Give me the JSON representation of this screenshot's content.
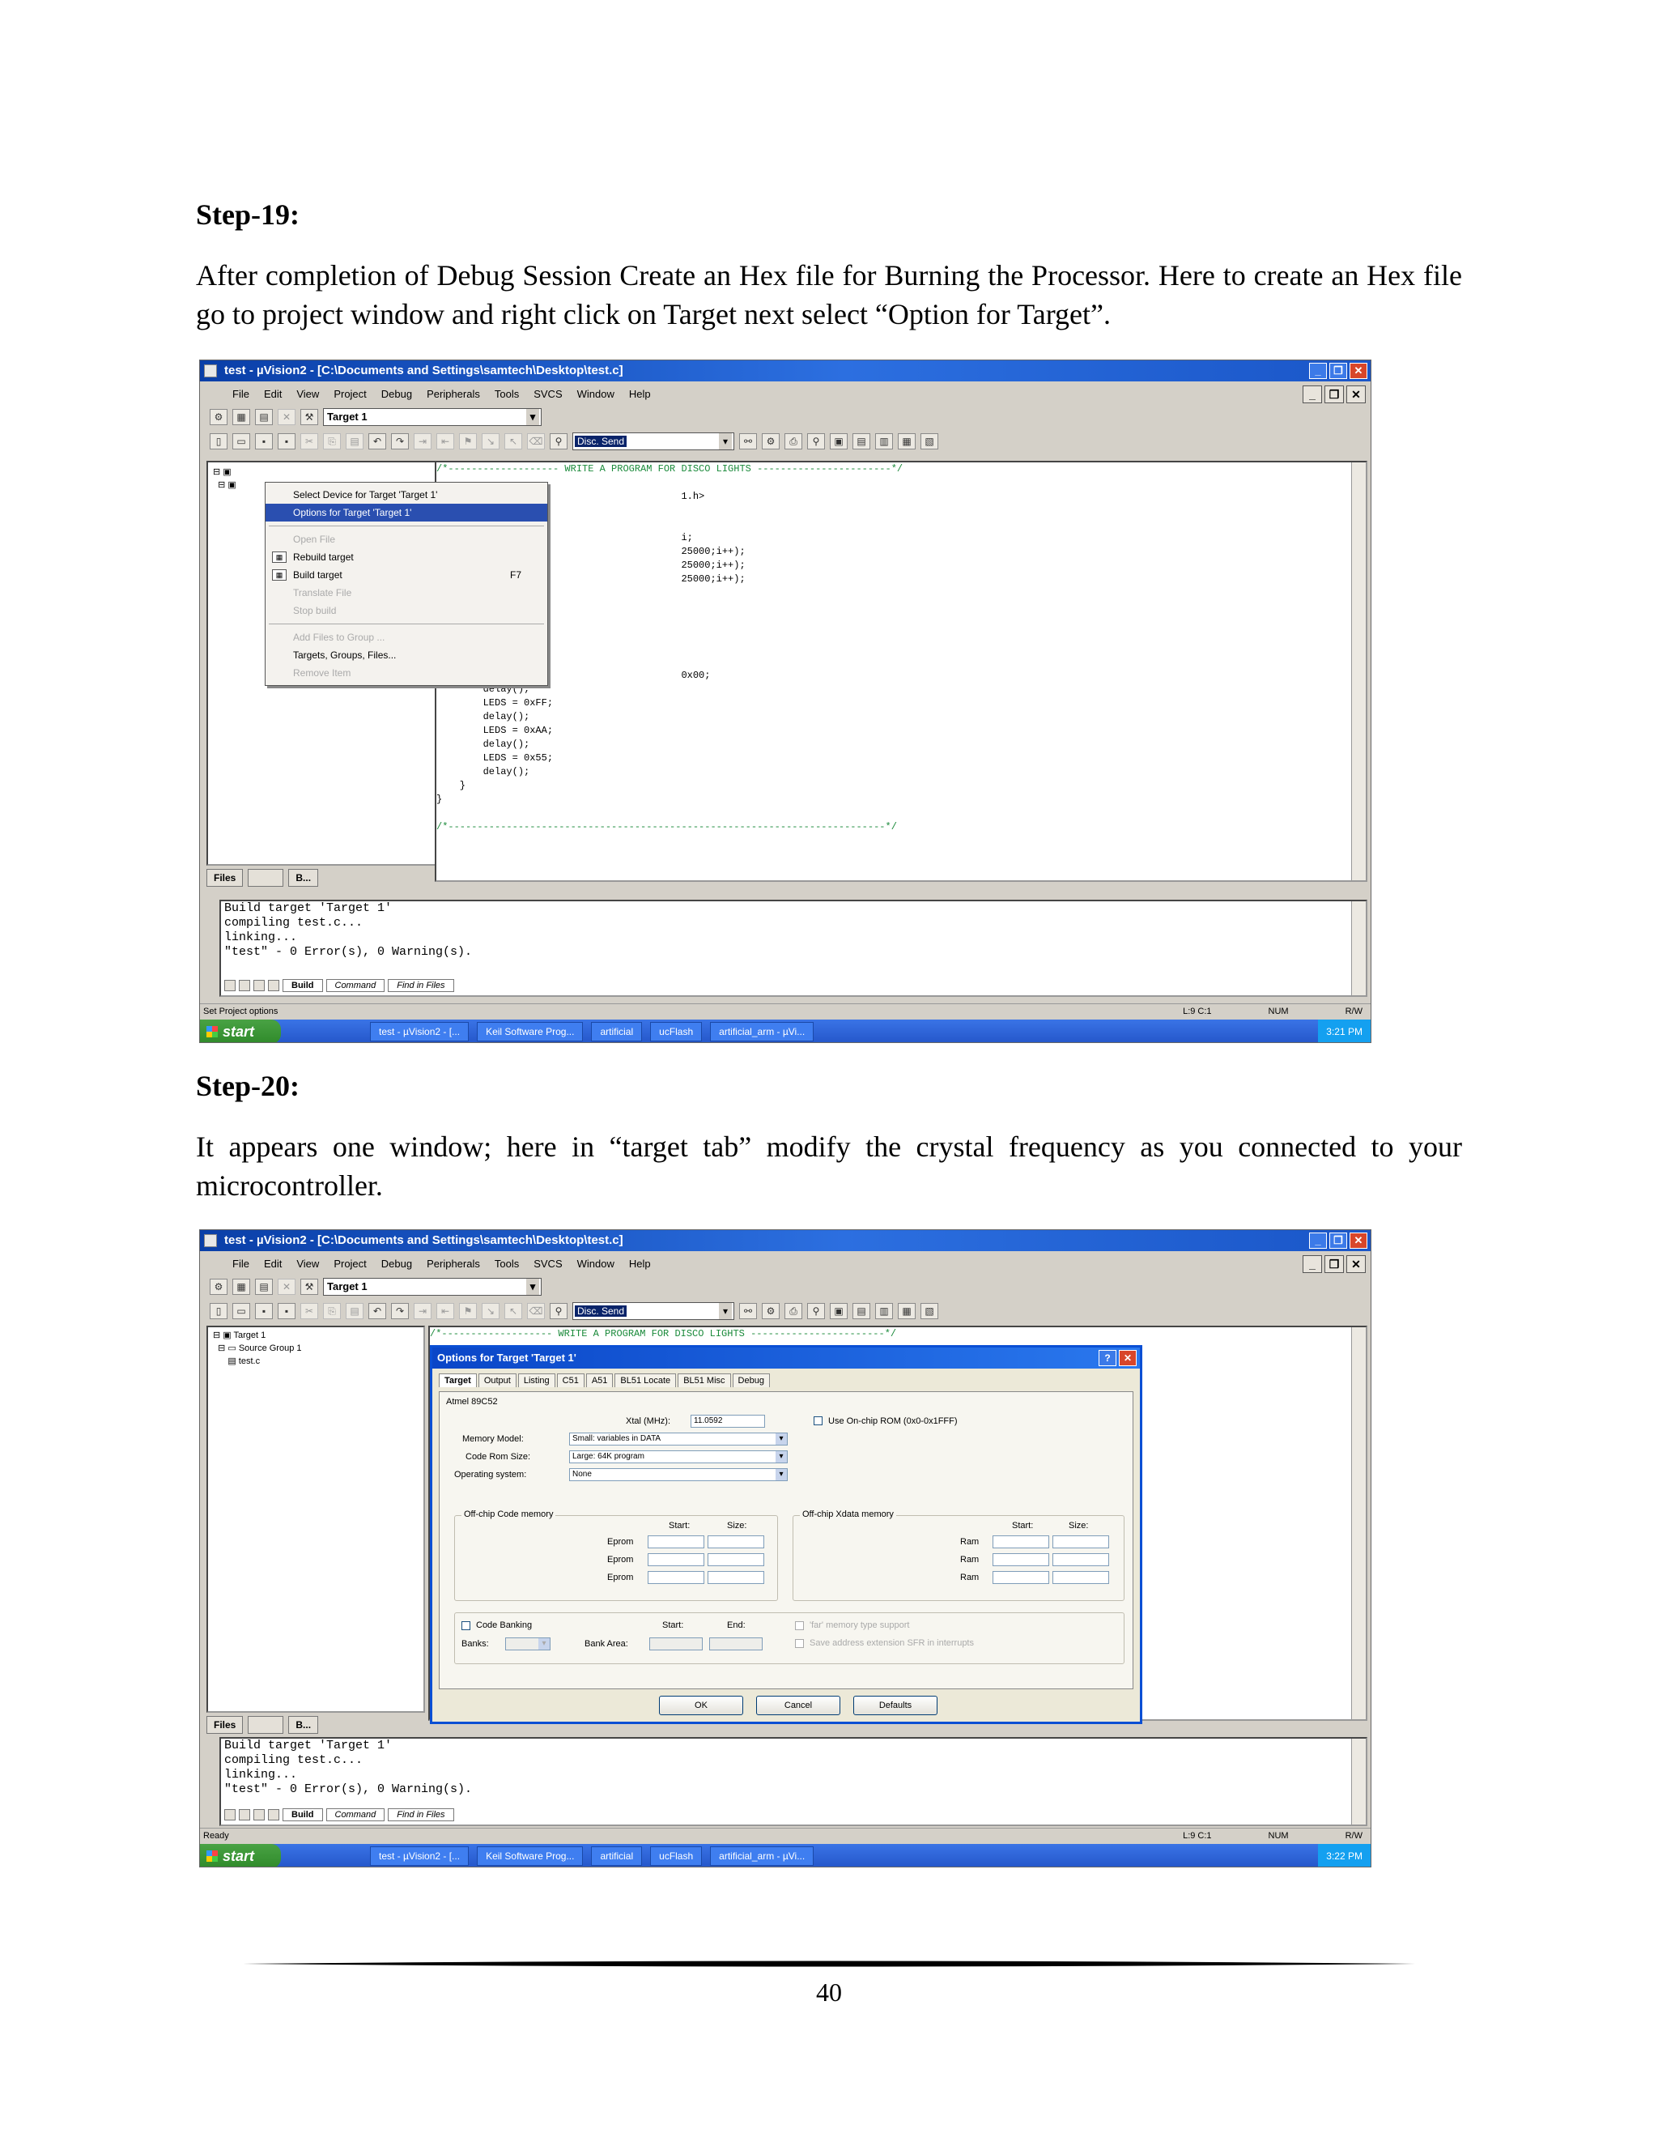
{
  "step19": {
    "heading": "Step-19:",
    "paragraph": "After completion of Debug Session Create an Hex file for Burning the Processor. Here to create an Hex file go to project window and right click on Target next select “Option for Target”."
  },
  "step20": {
    "heading": "Step-20:",
    "paragraph": "It appears one window; here in “target tab” modify the crystal frequency as you connected to your microcontroller."
  },
  "page_number": "40",
  "screenshot1": {
    "title": "test - µVision2 - [C:\\Documents and Settings\\samtech\\Desktop\\test.c]",
    "menu": [
      "File",
      "Edit",
      "View",
      "Project",
      "Debug",
      "Peripherals",
      "Tools",
      "SVCS",
      "Window",
      "Help"
    ],
    "target_select": "Target 1",
    "find_value": "Disc. Send",
    "editor_lines": [
      "/*------------------- WRITE A PROGRAM FOR DISCO LIGHTS -----------------------*/",
      "",
      "                                          1.h>",
      "",
      "",
      "                                          i;",
      "                                          25000;i++);",
      "                                          25000;i++);",
      "                                          25000;i++);",
      "",
      "",
      "",
      "",
      "",
      "",
      "                                          0x00;",
      "        delay();",
      "        LEDS = 0xFF;",
      "        delay();",
      "        LEDS = 0xAA;",
      "        delay();",
      "        LEDS = 0x55;",
      "        delay();",
      "    }",
      "}",
      "",
      "/*---------------------------------------------------------------------------*/"
    ],
    "context_menu": {
      "items": [
        {
          "label": "Select Device for Target 'Target 1'",
          "state": "normal"
        },
        {
          "label": "Options for Target 'Target 1'",
          "state": "highlight"
        },
        {
          "label": "",
          "state": "sep"
        },
        {
          "label": "Open File",
          "state": "dim"
        },
        {
          "label": "Rebuild target",
          "state": "normal",
          "icon": "rebuild-icon"
        },
        {
          "label": "Build target",
          "state": "normal",
          "shortcut": "F7",
          "icon": "build-icon"
        },
        {
          "label": "Translate File",
          "state": "dim"
        },
        {
          "label": "Stop build",
          "state": "dim"
        },
        {
          "label": "",
          "state": "sep"
        },
        {
          "label": "Add Files to Group ...",
          "state": "dim"
        },
        {
          "label": "Targets, Groups, Files...",
          "state": "normal"
        },
        {
          "label": "Remove Item",
          "state": "dim"
        }
      ]
    },
    "pane_tabs": [
      "Files",
      "",
      "B..."
    ],
    "output_lines": [
      "Build target 'Target 1'",
      "compiling test.c...",
      "linking...",
      "\"test\" - 0 Error(s), 0 Warning(s)."
    ],
    "output_tabs": [
      "Build",
      "Command",
      "Find in Files"
    ],
    "status_text": "Set Project options",
    "status_cells": [
      "L:9 C:1",
      "NUM",
      "R/W"
    ],
    "start_label": "start",
    "taskbar_items": [
      "test - µVision2 - [...",
      "Keil Software Prog...",
      "artificial",
      "ucFlash",
      "artificial_arm - µVi...",
      "3:21 PM"
    ]
  },
  "screenshot2": {
    "title": "test - µVision2 - [C:\\Documents and Settings\\samtech\\Desktop\\test.c]",
    "menu": [
      "File",
      "Edit",
      "View",
      "Project",
      "Debug",
      "Peripherals",
      "Tools",
      "SVCS",
      "Window",
      "Help"
    ],
    "target_select": "Target 1",
    "find_value": "Disc. Send",
    "editor_header": "/*------------------- WRITE A PROGRAM FOR DISCO LIGHTS -----------------------*/",
    "tree": [
      "Target 1",
      "Source Group 1",
      "test.c"
    ],
    "pane_tabs": [
      "Files",
      "",
      "B..."
    ],
    "dialog": {
      "title": "Options for Target 'Target 1'",
      "tabs": [
        "Target",
        "Output",
        "Listing",
        "C51",
        "A51",
        "BL51 Locate",
        "BL51 Misc",
        "Debug"
      ],
      "device": "Atmel 89C52",
      "xtal_label": "Xtal (MHz):",
      "xtal_value": "11.0592",
      "onchip_rom_label": "Use On-chip ROM (0x0-0x1FFF)",
      "memory_model_label": "Memory Model:",
      "memory_model_value": "Small: variables in DATA",
      "code_rom_label": "Code Rom Size:",
      "code_rom_value": "Large: 64K program",
      "os_label": "Operating system:",
      "os_value": "None",
      "offchip_code_title": "Off-chip Code memory",
      "offchip_xdata_title": "Off-chip Xdata memory",
      "start_label": "Start:",
      "size_label": "Size:",
      "end_label": "End:",
      "eprom_label": "Eprom",
      "ram_label": "Ram",
      "code_banking_label": "Code Banking",
      "banks_label": "Banks:",
      "bank_area_label": "Bank Area:",
      "far_memory_label": "'far' memory type support",
      "save_address_label": "Save address extension SFR in interrupts",
      "ok": "OK",
      "cancel": "Cancel",
      "defaults": "Defaults"
    },
    "output_lines": [
      "Build target 'Target 1'",
      "compiling test.c...",
      "linking...",
      "\"test\" - 0 Error(s), 0 Warning(s)."
    ],
    "output_tabs": [
      "Build",
      "Command",
      "Find in Files"
    ],
    "status_text": "Ready",
    "status_cells": [
      "L:9 C:1",
      "NUM",
      "R/W"
    ],
    "start_label": "start",
    "taskbar_items": [
      "test - µVision2 - [...",
      "Keil Software Prog...",
      "artificial",
      "ucFlash",
      "artificial_arm - µVi...",
      "3:22 PM"
    ]
  }
}
